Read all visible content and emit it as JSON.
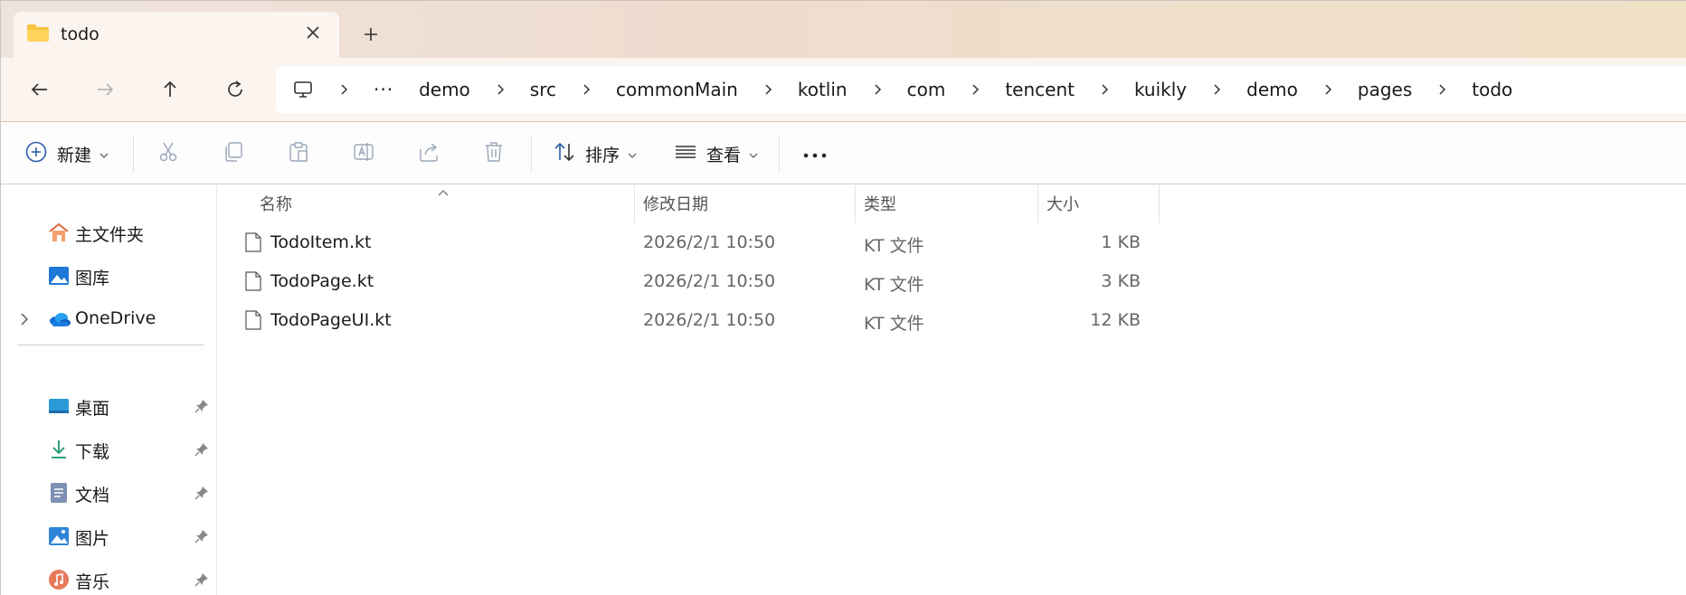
{
  "tab": {
    "title": "todo",
    "close_icon": "close-icon",
    "new_tab_icon": "plus-icon"
  },
  "nav": {
    "back_icon": "arrow-left-icon",
    "forward_icon": "arrow-right-icon",
    "up_icon": "arrow-up-icon",
    "refresh_icon": "refresh-icon"
  },
  "address": {
    "root_icon": "computer-icon",
    "overflow": "···",
    "crumbs": [
      "demo",
      "src",
      "commonMain",
      "kotlin",
      "com",
      "tencent",
      "kuikly",
      "demo",
      "pages",
      "todo"
    ]
  },
  "toolbar": {
    "new_label": "新建",
    "sort_label": "排序",
    "view_label": "查看",
    "more": "···"
  },
  "sidebar": {
    "items": [
      {
        "label": "主文件夹",
        "icon": "home-icon"
      },
      {
        "label": "图库",
        "icon": "gallery-icon"
      },
      {
        "label": "OneDrive",
        "icon": "cloud-icon"
      },
      {
        "label": "桌面",
        "icon": "desktop-icon"
      },
      {
        "label": "下载",
        "icon": "download-icon"
      },
      {
        "label": "文档",
        "icon": "document-icon"
      },
      {
        "label": "图片",
        "icon": "pictures-icon"
      },
      {
        "label": "音乐",
        "icon": "music-icon"
      }
    ]
  },
  "columns": {
    "name": "名称",
    "modified": "修改日期",
    "type": "类型",
    "size": "大小"
  },
  "files": [
    {
      "name": "TodoItem.kt",
      "modified": "2026/2/1 10:50",
      "type": "KT 文件",
      "size": "1 KB"
    },
    {
      "name": "TodoPage.kt",
      "modified": "2026/2/1 10:50",
      "type": "KT 文件",
      "size": "3 KB"
    },
    {
      "name": "TodoPageUI.kt",
      "modified": "2026/2/1 10:50",
      "type": "KT 文件",
      "size": "12 KB"
    }
  ],
  "colors": {
    "accent": "#0067c0",
    "titlebar": "#efdccf",
    "toolbar_border": "#e6c9b4"
  }
}
